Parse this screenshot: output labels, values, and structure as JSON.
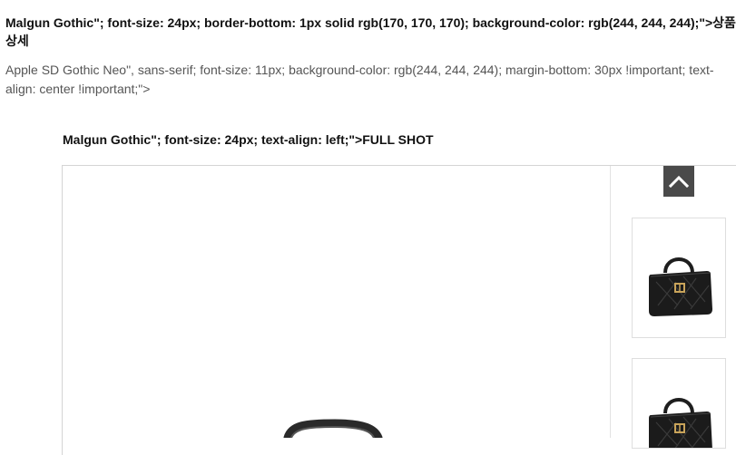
{
  "section": {
    "heading_text": "Malgun Gothic\"; font-size: 24px; border-bottom: 1px solid rgb(170, 170, 170); background-color: rgb(244, 244, 244);\">상품상세",
    "subtext": "Apple SD Gothic Neo\", sans-serif; font-size: 11px; background-color: rgb(244, 244, 244); margin-bottom: 30px !important; text-align: center !important;\">"
  },
  "gallery": {
    "title": "FULL SHOT",
    "title_prefix": "Malgun Gothic\"; font-size: 24px; text-align: left;\">",
    "scroll_top_icon": "chevron-up-icon",
    "thumbnails": [
      {
        "icon": "handbag-icon"
      },
      {
        "icon": "handbag-icon"
      }
    ],
    "main_image_icon": "handbag-icon"
  },
  "colors": {
    "scroll_button": "#4a4a4a",
    "bag": "#1b1b1b",
    "hardware": "#c9a45a"
  }
}
